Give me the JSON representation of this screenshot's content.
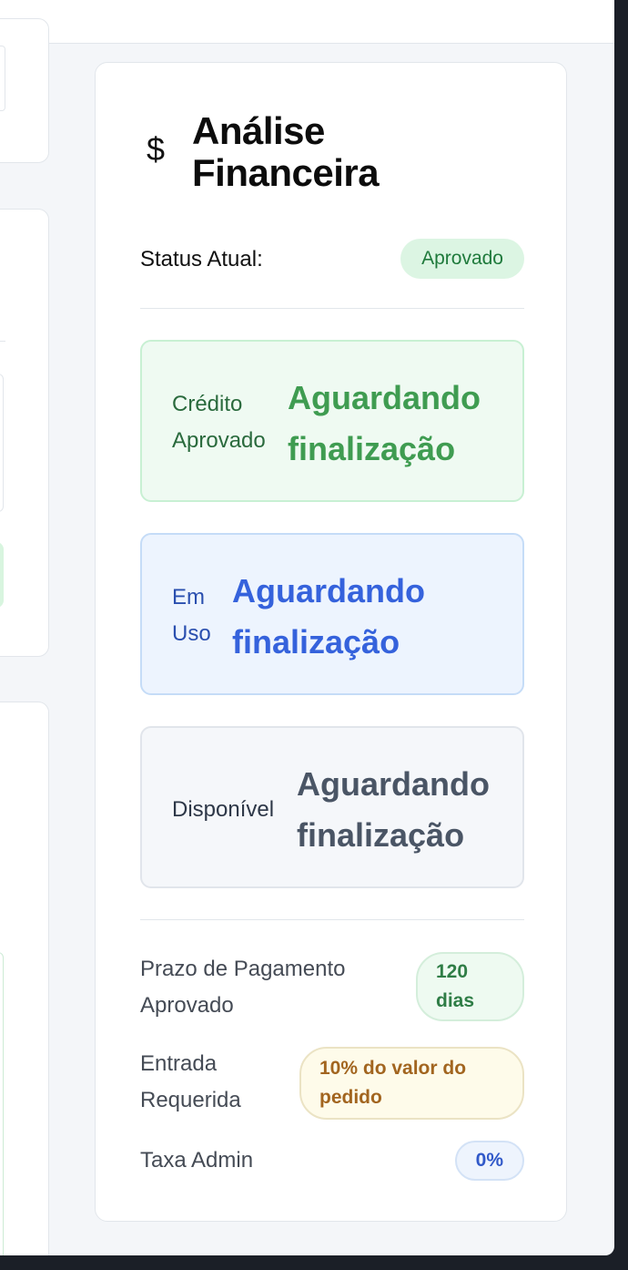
{
  "panel": {
    "icon": "dollar-icon",
    "icon_glyph": "$",
    "title": "Análise Financeira",
    "status": {
      "label": "Status Atual:",
      "badge": "Aprovado"
    },
    "metrics": [
      {
        "label": "Crédito Aprovado",
        "value": "Aguardando finalização",
        "color": "#3f9c51"
      },
      {
        "label": "Em Uso",
        "value": "Aguardando finalização",
        "color": "#3562dc"
      },
      {
        "label": "Disponível",
        "value": "Aguardando finalização",
        "color": "#4a5565"
      }
    ],
    "info": [
      {
        "label": "Prazo de Pagamento Aprovado",
        "value": "120 dias"
      },
      {
        "label": "Entrada Requerida",
        "value": "10% do valor do pedido"
      },
      {
        "label": "Taxa Admin",
        "value": "0%"
      }
    ]
  },
  "colors": {
    "success_badge_bg": "#dcf5e3",
    "success_text": "#1f7a3c",
    "warning_text": "#a2651f",
    "info_text": "#3159c9"
  }
}
